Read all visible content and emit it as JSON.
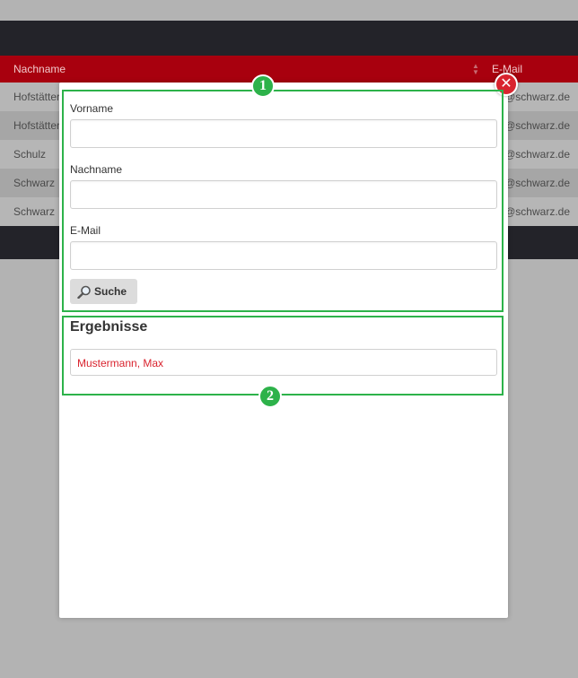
{
  "background_table": {
    "header": {
      "col_lastname": "Nachname",
      "col_email": "E-Mail"
    },
    "rows": [
      {
        "lastname": "Hofstätter",
        "email": "@schwarz.de"
      },
      {
        "lastname": "Hofstätter",
        "email": "@schwarz.de"
      },
      {
        "lastname": "Schulz",
        "email": "@schwarz.de"
      },
      {
        "lastname": "Schwarz",
        "email": "@schwarz.de"
      },
      {
        "lastname": "Schwarz",
        "email": "@schwarz.de"
      }
    ]
  },
  "dialog": {
    "close_icon": "close-icon",
    "search_form": {
      "firstname_label": "Vorname",
      "firstname_value": "",
      "lastname_label": "Nachname",
      "lastname_value": "",
      "email_label": "E-Mail",
      "email_value": "",
      "search_button_label": "Suche",
      "search_button_icon": "magnifier-icon"
    },
    "results": {
      "title": "Ergebnisse",
      "items": [
        {
          "label": "Mustermann, Max"
        }
      ]
    }
  },
  "annotations": {
    "marker_1": "1",
    "marker_2": "2",
    "color": "#2db24a"
  },
  "colors": {
    "header_red": "#a8000e",
    "dark_bar": "#232329",
    "close_red": "#d9232e",
    "result_text": "#d9232e"
  }
}
